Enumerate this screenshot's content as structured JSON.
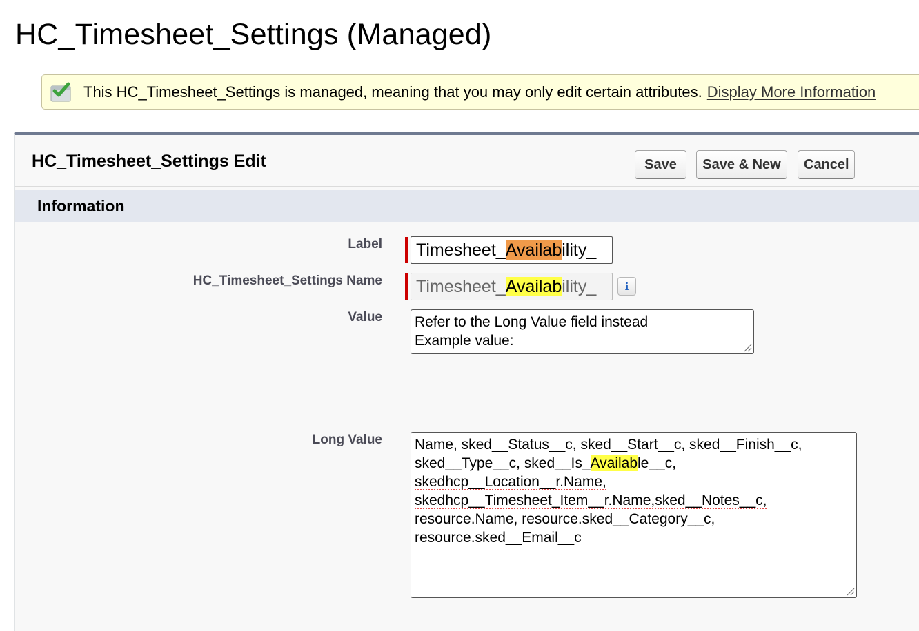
{
  "page": {
    "title": "HC_Timesheet_Settings (Managed)"
  },
  "banner": {
    "message": "This HC_Timesheet_Settings is managed, meaning that you may only edit certain attributes.",
    "link": "Display More Information",
    "icon": "managed-check-icon"
  },
  "edit_block": {
    "title": "HC_Timesheet_Settings Edit",
    "buttons": {
      "save": "Save",
      "save_new": "Save & New",
      "cancel": "Cancel"
    },
    "section": "Information"
  },
  "fields": {
    "label": {
      "label": "Label",
      "value_pre": "Timesheet_",
      "value_hl": "Availab",
      "value_post": "ility_",
      "highlight_color": "#f09a4a"
    },
    "name": {
      "label": "HC_Timesheet_Settings Name",
      "value_pre": "Timesheet_",
      "value_hl": "Availab",
      "value_post": "ility_",
      "highlight_color": "#ffff47",
      "info_icon": "i"
    },
    "value": {
      "label": "Value",
      "lines": [
        "Refer to the Long Value field instead",
        "Example value:"
      ]
    },
    "long_value": {
      "label": "Long Value",
      "line1": "Name, sked__Status__c, sked__Start__c, sked__Finish__c,",
      "line2_pre": "sked__Type__c, sked__Is_",
      "line2_hl": "Availab",
      "line2_post": "le__c,",
      "line3": "skedhcp__Location__r.Name,",
      "line4": "skedhcp__Timesheet_Item__r.Name,sked__Notes__c,",
      "line5": "resource.Name, resource.sked__Category__c,",
      "line6": "resource.sked__Email__c"
    }
  }
}
